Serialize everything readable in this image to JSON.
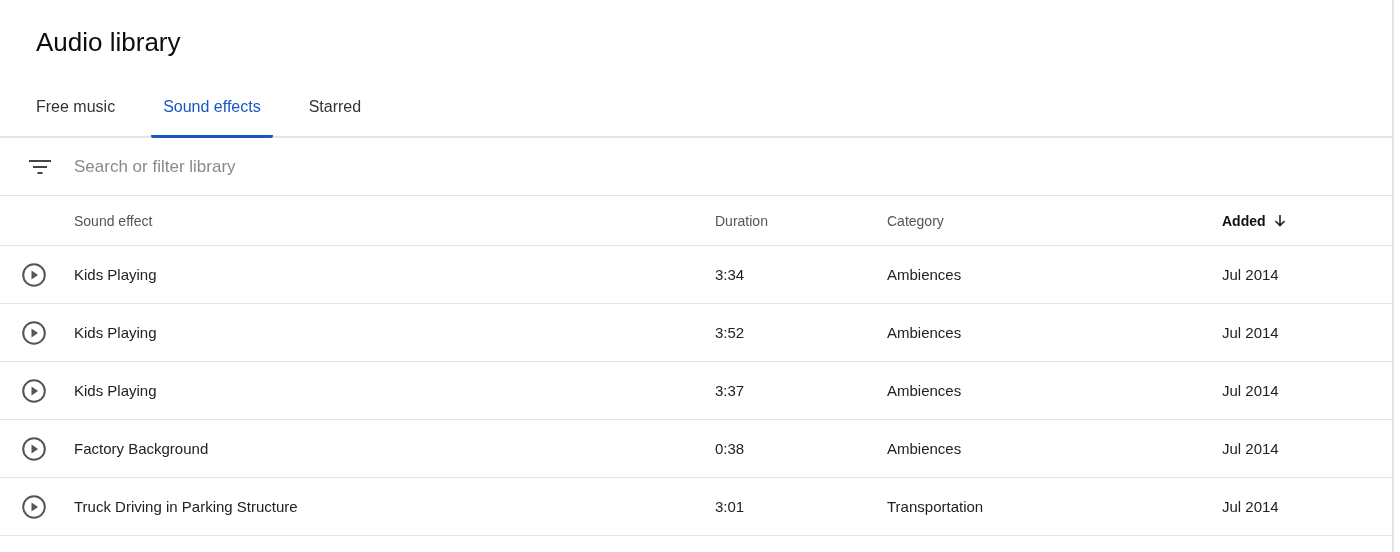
{
  "title": "Audio library",
  "tabs": [
    {
      "label": "Free music",
      "selected": false
    },
    {
      "label": "Sound effects",
      "selected": true
    },
    {
      "label": "Starred",
      "selected": false
    }
  ],
  "search": {
    "placeholder": "Search or filter library"
  },
  "table": {
    "columns": [
      {
        "label": "Sound effect",
        "sorted": false
      },
      {
        "label": "Duration",
        "sorted": false
      },
      {
        "label": "Category",
        "sorted": false
      },
      {
        "label": "Added",
        "sorted": true
      }
    ],
    "rows": [
      {
        "cells": [
          "Kids Playing",
          "3:34",
          "Ambiences",
          "Jul 2014"
        ]
      },
      {
        "cells": [
          "Kids Playing",
          "3:52",
          "Ambiences",
          "Jul 2014"
        ]
      },
      {
        "cells": [
          "Kids Playing",
          "3:37",
          "Ambiences",
          "Jul 2014"
        ]
      },
      {
        "cells": [
          "Factory Background",
          "0:38",
          "Ambiences",
          "Jul 2014"
        ]
      },
      {
        "cells": [
          "Truck Driving in Parking Structure",
          "3:01",
          "Transportation",
          "Jul 2014"
        ]
      }
    ]
  }
}
